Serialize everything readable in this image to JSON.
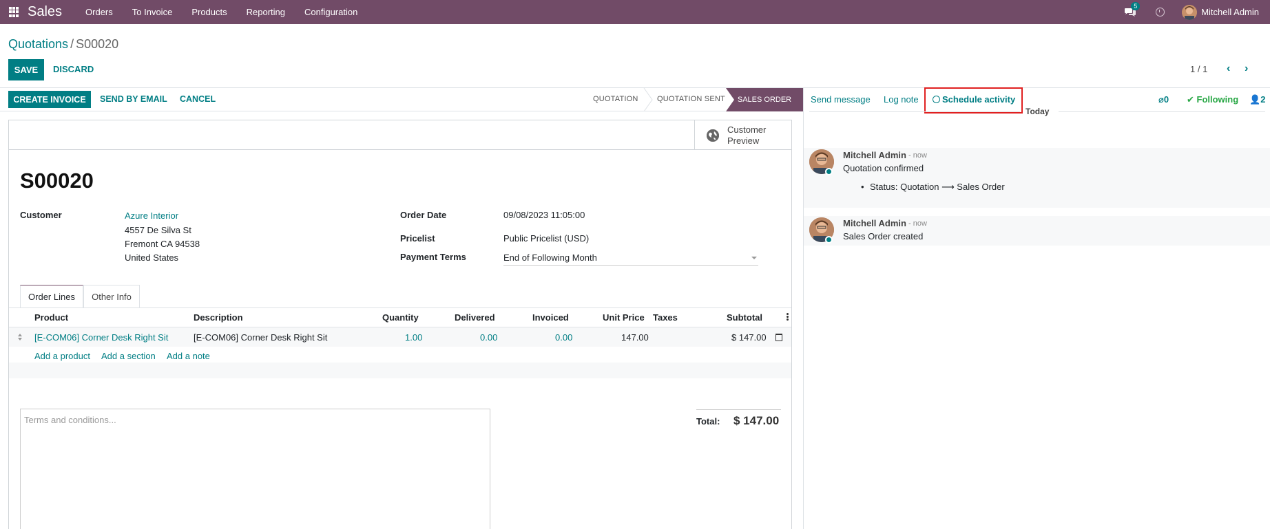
{
  "topbar": {
    "app_name": "Sales",
    "menu": [
      "Orders",
      "To Invoice",
      "Products",
      "Reporting",
      "Configuration"
    ],
    "chat_badge": "5",
    "user_name": "Mitchell Admin"
  },
  "breadcrumb": {
    "parent": "Quotations",
    "separator": "/",
    "current": "S00020"
  },
  "actions": {
    "save": "SAVE",
    "discard": "DISCARD"
  },
  "pager": {
    "value": "1 / 1",
    "prev": "‹",
    "next": "›"
  },
  "statusbar": {
    "buttons": [
      "CREATE INVOICE",
      "SEND BY EMAIL",
      "CANCEL"
    ],
    "stages": [
      "QUOTATION",
      "QUOTATION SENT",
      "SALES ORDER"
    ],
    "active_stage": "SALES ORDER"
  },
  "form": {
    "preview": "Customer Preview",
    "order_name": "S00020",
    "customer_label": "Customer",
    "customer_name": "Azure Interior",
    "address": [
      "4557 De Silva St",
      "Fremont CA 94538",
      "United States"
    ],
    "order_date_label": "Order Date",
    "order_date": "09/08/2023 11:05:00",
    "pricelist_label": "Pricelist",
    "pricelist": "Public Pricelist (USD)",
    "payment_terms_label": "Payment Terms",
    "payment_terms": "End of Following Month",
    "tabs": [
      "Order Lines",
      "Other Info"
    ]
  },
  "order_lines": {
    "headers": [
      "Product",
      "Description",
      "Quantity",
      "Delivered",
      "Invoiced",
      "Unit Price",
      "Taxes",
      "Subtotal"
    ],
    "rows": [
      {
        "product": "[E-COM06] Corner Desk Right Sit",
        "description": "[E-COM06] Corner Desk Right Sit",
        "quantity": "1.00",
        "delivered": "0.00",
        "invoiced": "0.00",
        "unit_price": "147.00",
        "taxes": "",
        "subtotal": "$ 147.00"
      }
    ],
    "add_links": [
      "Add a product",
      "Add a section",
      "Add a note"
    ]
  },
  "footer": {
    "terms_placeholder": "Terms and conditions...",
    "total_label": "Total:",
    "total_value": "$ 147.00"
  },
  "chatter": {
    "send_message": "Send message",
    "log_note": "Log note",
    "schedule_activity": "Schedule activity",
    "attachments_count": "0",
    "following": "Following",
    "followers_count": "2",
    "date_separator": "Today",
    "messages": [
      {
        "author": "Mitchell Admin",
        "time": "- now",
        "body": "Quotation confirmed",
        "tracking": "Status: Quotation ⟶ Sales Order"
      },
      {
        "author": "Mitchell Admin",
        "time": "- now",
        "body": "Sales Order created"
      }
    ]
  },
  "colors": {
    "brand": "#714b67",
    "primary": "#017e84",
    "highlight": "#e02020",
    "following": "#28a745"
  }
}
